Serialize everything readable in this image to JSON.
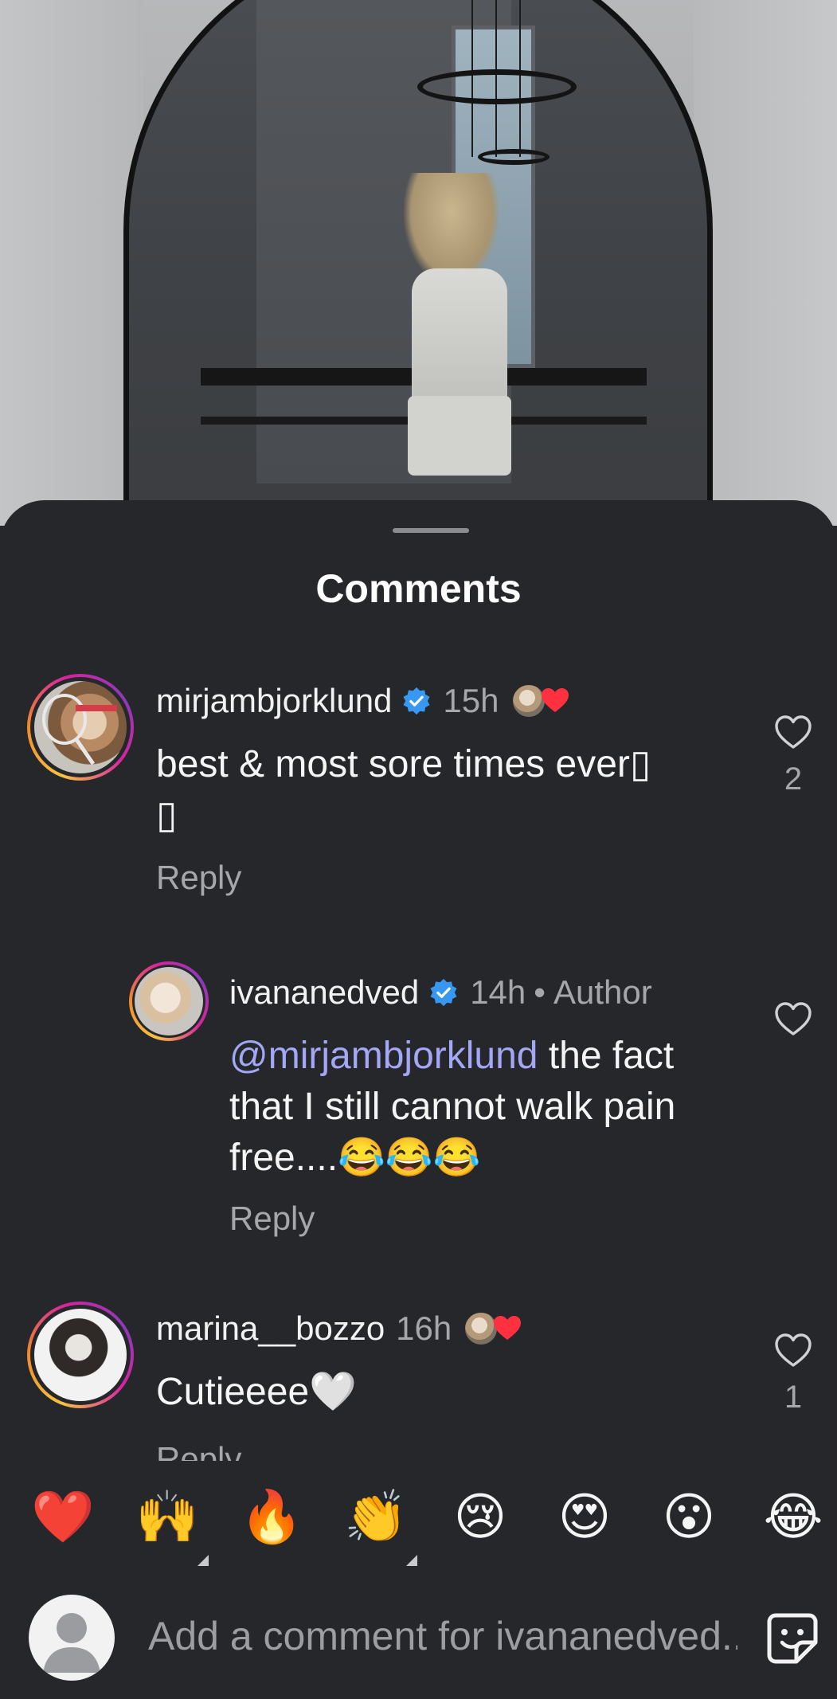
{
  "sheet": {
    "title": "Comments"
  },
  "comments": [
    {
      "username": "mirjambjorklund",
      "verified": true,
      "time": "15h",
      "text": "best & most sore times ever▯\n▯",
      "reply_label": "Reply",
      "like_count": "2",
      "liked_by_author": true
    },
    {
      "username": "ivananedved",
      "verified": true,
      "time": "14h",
      "badge": "Author",
      "mention": "@mirjambjorklund",
      "text": " the fact that I still cannot walk pain free....😂😂😂",
      "reply_label": "Reply"
    },
    {
      "username": "marina__bozzo",
      "verified": false,
      "time": "16h",
      "text": "Cutieeee🤍",
      "reply_label": "Reply",
      "like_count": "1",
      "liked_by_author": true
    }
  ],
  "quick_reactions": [
    {
      "emoji": "❤️",
      "icon": "red-heart-emoji"
    },
    {
      "emoji": "🙌",
      "icon": "raising-hands-emoji",
      "has_variants": true
    },
    {
      "emoji": "🔥",
      "icon": "fire-emoji"
    },
    {
      "emoji": "👏",
      "icon": "clapping-hands-emoji",
      "has_variants": true
    },
    {
      "emoji": "😢",
      "icon": "crying-face-emoji"
    },
    {
      "emoji": "😍",
      "icon": "heart-eyes-emoji"
    },
    {
      "emoji": "😮",
      "icon": "surprised-face-emoji"
    },
    {
      "emoji": "😂",
      "icon": "tears-of-joy-emoji"
    }
  ],
  "composer": {
    "placeholder": "Add a comment for ivananedved..."
  },
  "colors": {
    "sheet_background": "#25272b",
    "mention": "#a3a7f5",
    "secondary_text": "#a5a7ab",
    "verified_blue": "#3897f0",
    "heart_red": "#ff3040"
  }
}
